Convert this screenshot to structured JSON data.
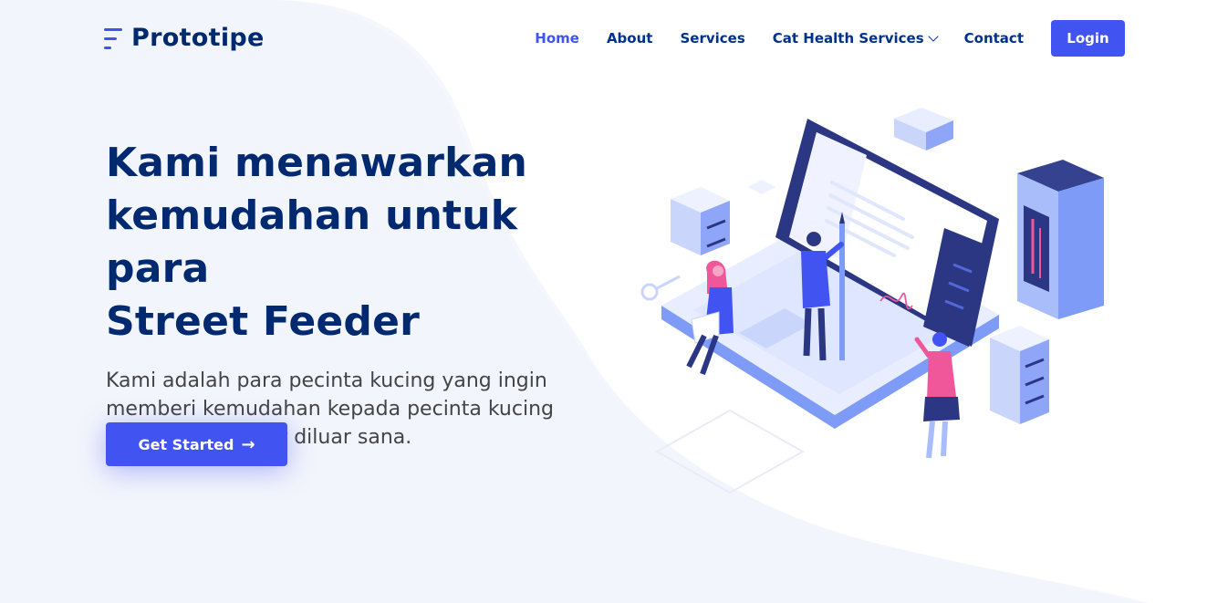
{
  "brand": {
    "name": "Prototipe"
  },
  "nav": {
    "items": [
      {
        "label": "Home",
        "active": true
      },
      {
        "label": "About",
        "active": false
      },
      {
        "label": "Services",
        "active": false
      },
      {
        "label": "Cat Health Services",
        "active": false,
        "dropdown": true
      },
      {
        "label": "Contact",
        "active": false
      }
    ],
    "login_label": "Login"
  },
  "hero": {
    "title_lines": [
      "Kami menawarkan",
      "kemudahan untuk para",
      "Street Feeder"
    ],
    "subtitle_lines": [
      "Kami adalah para pecinta kucing yang ingin",
      "memberi kemudahan kepada pecinta kucing",
      "atau street feeder diluar sana."
    ],
    "cta_label": "Get Started",
    "cta_icon": "arrow-right-icon"
  },
  "colors": {
    "accent": "#4154f1",
    "heading": "#012970",
    "nav_text": "#013289",
    "body_text": "#444444",
    "blob": "#f6f7fd"
  }
}
